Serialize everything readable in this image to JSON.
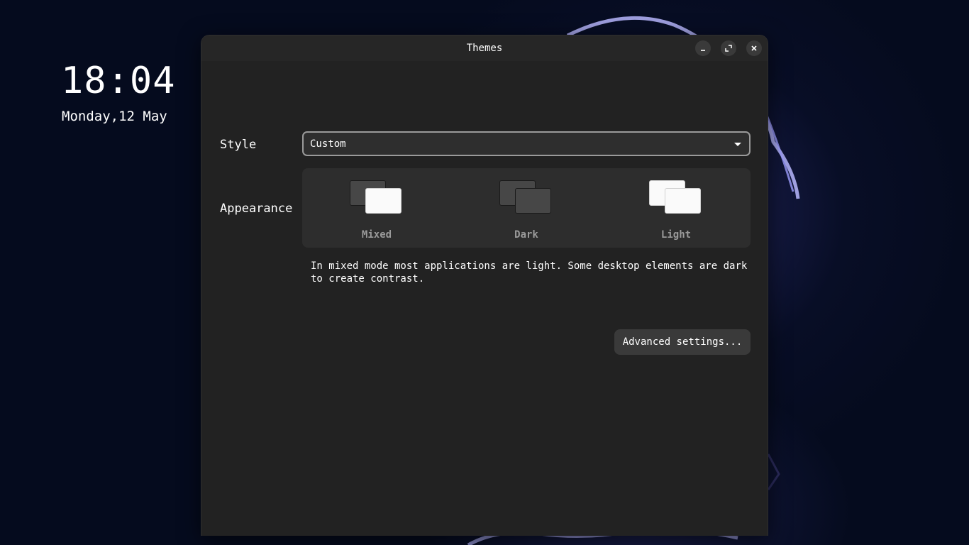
{
  "desktop": {
    "clock": "18:04",
    "date": "Monday,12 May"
  },
  "window": {
    "title": "Themes",
    "controls": {
      "minimize_icon": "minimize-icon",
      "maximize_icon": "maximize-icon",
      "close_icon": "close-icon"
    }
  },
  "style": {
    "label": "Style",
    "selected": "Custom"
  },
  "appearance": {
    "label": "Appearance",
    "options": [
      {
        "label": "Mixed"
      },
      {
        "label": "Dark"
      },
      {
        "label": "Light"
      }
    ],
    "description": "In mixed mode most applications are light. Some desktop elements are dark to create contrast."
  },
  "buttons": {
    "advanced": "Advanced settings..."
  },
  "colors": {
    "window_bg": "#222222",
    "accent_text": "#ffffff",
    "muted_text": "#9a9a9a"
  }
}
